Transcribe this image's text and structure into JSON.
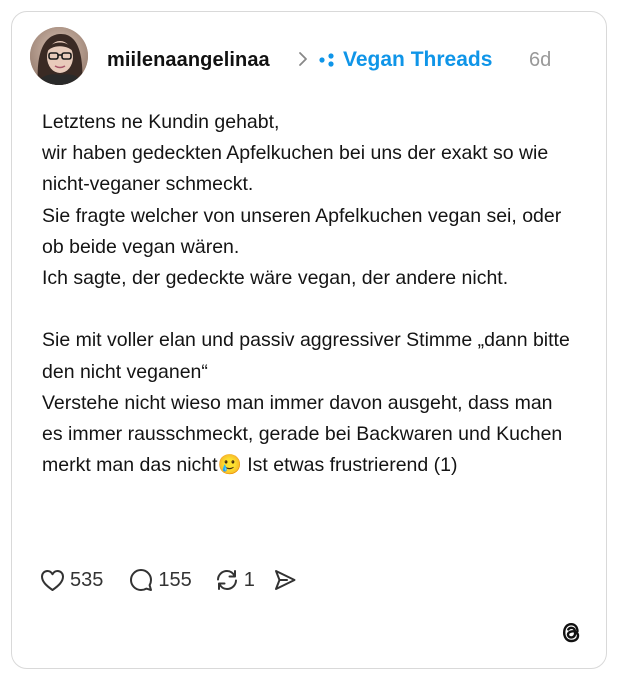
{
  "post": {
    "author": {
      "username": "miilenaangelinaa",
      "avatar_icon": "profile-photo"
    },
    "separator_icon": "chevron-right-icon",
    "community": {
      "icon": "community-dots-icon",
      "name": "Vegan Threads",
      "color": "#0f95e8"
    },
    "time_ago": "6d",
    "text": "Letztens ne Kundin gehabt,\nwir haben gedeckten Apfelkuchen bei uns der exakt so wie nicht-veganer schmeckt.\nSie fragte welcher von unseren Apfelkuchen vegan sei, oder ob beide vegan wären.\nIch sagte, der gedeckte wäre vegan, der andere nicht.\n\nSie mit voller elan und passiv aggressiver Stimme „dann bitte den nicht veganen“\nVerstehe nicht wieso man immer davon ausgeht, dass man es immer rausschmeckt, gerade bei Backwaren und Kuchen merkt man das nicht🥲 Ist etwas frustrierend (1)",
    "actions": {
      "like": {
        "icon": "heart-icon",
        "count": "535"
      },
      "reply": {
        "icon": "comment-bubble-icon",
        "count": "155"
      },
      "repost": {
        "icon": "repost-icon",
        "count": "1"
      },
      "share": {
        "icon": "send-icon"
      }
    },
    "brand_icon": "threads-logo-icon"
  }
}
